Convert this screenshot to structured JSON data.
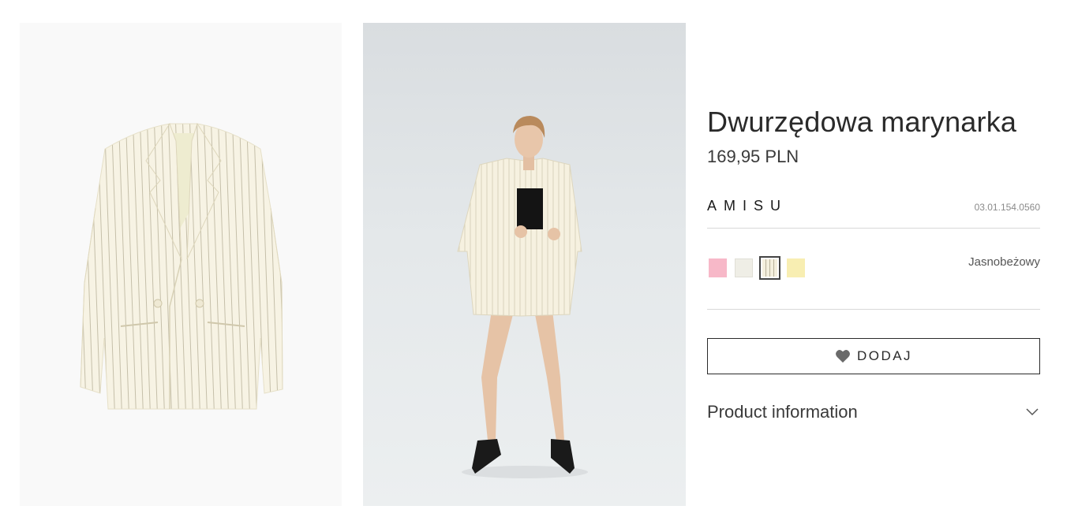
{
  "product": {
    "title": "Dwurzędowa marynarka",
    "price": "169,95 PLN",
    "brand": "AMISU",
    "sku": "03.01.154.0560",
    "selected_color": "Jasnobeżowy",
    "colors": [
      {
        "name": "pink",
        "hex": "#f7b8c8"
      },
      {
        "name": "off-white",
        "hex": "#efeee6"
      },
      {
        "name": "light-beige-pinstripe",
        "hex": "#f4efdd"
      },
      {
        "name": "yellow",
        "hex": "#f8eeb2"
      }
    ]
  },
  "actions": {
    "add_label": "DODAJ"
  },
  "accordion": {
    "product_information": "Product information"
  },
  "gallery": {
    "images": [
      {
        "subject": "pinstripe-blazer-flat"
      },
      {
        "subject": "model-wearing-blazer-and-skirt"
      }
    ]
  },
  "icons": {
    "heart": "heart-icon",
    "chevron": "chevron-down-icon"
  }
}
